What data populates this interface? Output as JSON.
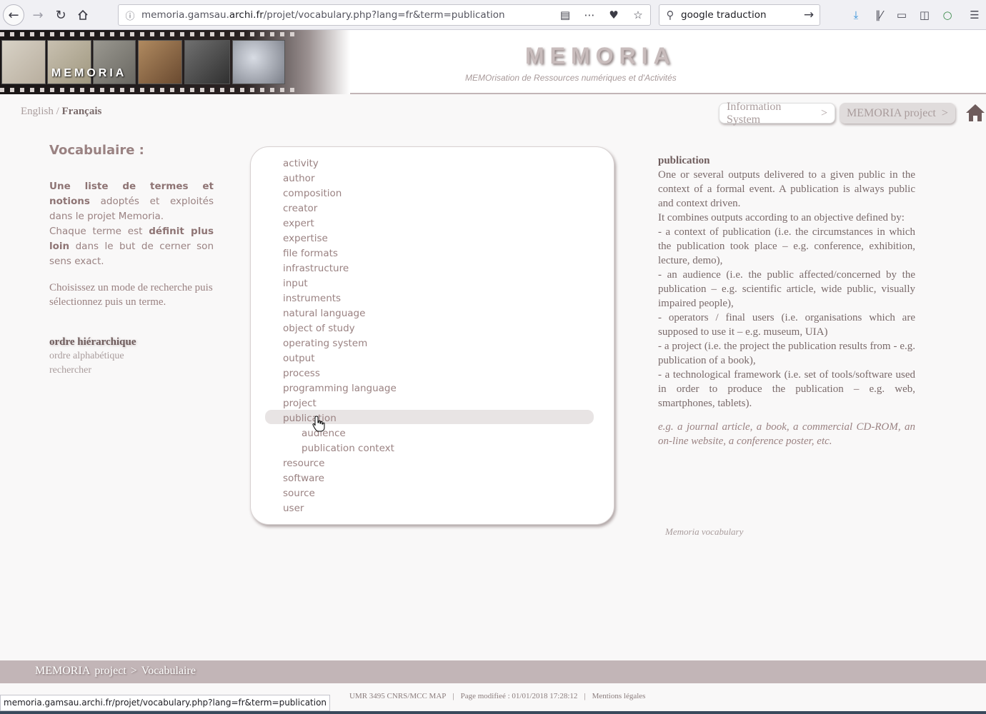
{
  "browser": {
    "url": "memoria.gamsau.archi.fr/projet/vocabulary.php?lang=fr&term=publication",
    "url_host": "memoria.gamsau.",
    "url_domain": "archi.fr",
    "url_path": "/projet/vocabulary.php?lang=fr&term=publication",
    "search_query": "google traduction",
    "status_url": "memoria.gamsau.archi.fr/projet/vocabulary.php?lang=fr&term=publication"
  },
  "header": {
    "logo_text": "MEMORIA",
    "title": "MEMORIA",
    "subtitle": "MEMOrisation de Ressources numériques et d'Activités"
  },
  "lang": {
    "en": "English",
    "sep": "/",
    "fr": "Français"
  },
  "breadcrumbs": [
    {
      "label": "Information System",
      "arrow": ">"
    },
    {
      "label": "MEMORIA project",
      "arrow": ">"
    }
  ],
  "left": {
    "heading": "Vocabulaire :",
    "intro_b1": "Une liste de termes et notions",
    "intro_1": "adoptés et exploités dans le projet Memoria.",
    "intro_2": "Chaque terme est",
    "intro_b2": "définit plus loin",
    "intro_3": "dans le but de cerner son sens exact.",
    "choose": "Choisissez un mode de recherche puis sélectionnez puis un terme.",
    "modes": [
      {
        "label": "ordre hiérarchique",
        "active": true
      },
      {
        "label": "ordre alphabétique",
        "active": false
      },
      {
        "label": "rechercher",
        "active": false
      }
    ]
  },
  "terms": [
    {
      "label": "activity",
      "level": 0
    },
    {
      "label": "author",
      "level": 0
    },
    {
      "label": "composition",
      "level": 0
    },
    {
      "label": "creator",
      "level": 0
    },
    {
      "label": "expert",
      "level": 0
    },
    {
      "label": "expertise",
      "level": 0
    },
    {
      "label": "file formats",
      "level": 0
    },
    {
      "label": "infrastructure",
      "level": 0
    },
    {
      "label": "input",
      "level": 0
    },
    {
      "label": "instruments",
      "level": 0
    },
    {
      "label": "natural language",
      "level": 0
    },
    {
      "label": "object of study",
      "level": 0
    },
    {
      "label": "operating system",
      "level": 0
    },
    {
      "label": "output",
      "level": 0
    },
    {
      "label": "process",
      "level": 0
    },
    {
      "label": "programming language",
      "level": 0
    },
    {
      "label": "project",
      "level": 0
    },
    {
      "label": "publication",
      "level": 0,
      "selected": true
    },
    {
      "label": "audience",
      "level": 1
    },
    {
      "label": "publication context",
      "level": 1
    },
    {
      "label": "resource",
      "level": 0
    },
    {
      "label": "software",
      "level": 0
    },
    {
      "label": "source",
      "level": 0
    },
    {
      "label": "user",
      "level": 0
    }
  ],
  "definition": {
    "term": "publication",
    "lines": [
      "One or several outputs delivered to a given public in the context of a formal event. A publication is always public and context driven.",
      "It combines outputs according to an objective defined by:",
      "- a context of publication (i.e. the circumstances in which the publication took place – e.g. conference, exhibition, lecture, demo),",
      "- an audience (i.e. the public affected/concerned by the publication – e.g. scientific article, wide public, visually impaired people),",
      "- operators / final users (i.e. organisations which are supposed to use it – e.g. museum, UIA)",
      "- a project (i.e. the project the publication results from - e.g. publication of a book),",
      "- a technological framework (i.e. set of tools/software used in order to produce the publication – e.g. web, smartphones, tablets)."
    ],
    "example": "e.g. a journal article, a book, a commercial CD-ROM, an on-line website, a conference poster, etc.",
    "source": "Memoria vocabulary"
  },
  "footer": {
    "crumb_1": "MEMORIA",
    "crumb_2": "project",
    "crumb_sep": ">",
    "crumb_3": "Vocabulaire",
    "lab": "UMR 3495 CNRS/MCC MAP",
    "sep": "|",
    "modified": "Page modifieé : 01/01/2018 17:28:12",
    "legal": "Mentions légales"
  },
  "colors": {
    "text_brown": "#9a8282",
    "footer_band": "#c2b5b7",
    "highlight": "#e8e4e4"
  }
}
